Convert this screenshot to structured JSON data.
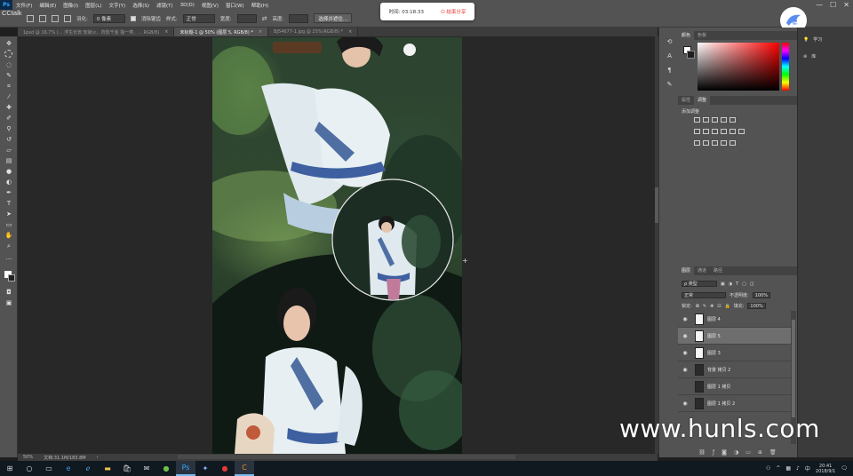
{
  "app": {
    "logo": "Ps",
    "menu": [
      "文件(F)",
      "编辑(E)",
      "图像(I)",
      "图层(L)",
      "文字(Y)",
      "选择(S)",
      "滤镜(T)",
      "3D(D)",
      "视图(V)",
      "窗口(W)",
      "帮助(H)"
    ],
    "window_controls": [
      "—",
      "☐",
      "✕"
    ]
  },
  "overlay": {
    "cctalk_label": "CCtalk",
    "timer_label": "时间: 03:18:33",
    "end_share_label": "结束分享"
  },
  "options": {
    "feather_label": "羽化:",
    "feather_value": "0 像素",
    "antialias_label": "消除锯齿",
    "style_label": "样式:",
    "style_value": "正常",
    "width_label": "宽度:",
    "height_label": "高度:",
    "select_mask_label": "选择并遮住..."
  },
  "tabs": [
    {
      "label": "1psd @ 16.7% (... 浮生长安 软锁火、背影千金 独一笑、... RGB/8)",
      "active": false
    },
    {
      "label": "未标题-1 @ 50% (图层 5, RGB/8) *",
      "active": true
    },
    {
      "label": "BJ54677-1.jpg @ 25%(RGB/8) *",
      "active": false
    }
  ],
  "status": {
    "zoom": "50%",
    "doc_size": "文档:31.1M/183.8M"
  },
  "panels": {
    "color_tabs": [
      "颜色",
      "色板"
    ],
    "adj_tabs": [
      "属性",
      "调整"
    ],
    "adj_title": "添加调整",
    "layers_tabs": [
      "图层",
      "通道",
      "路径"
    ],
    "kind_label": "ρ 类型",
    "blend_mode": "正常",
    "opacity_label": "不透明度:",
    "opacity_value": "100%",
    "lock_label": "锁定:",
    "fill_label": "填充:",
    "fill_value": "100%",
    "layers": [
      {
        "name": "图层 4",
        "selected": false
      },
      {
        "name": "图层 5",
        "selected": true
      },
      {
        "name": "图层 3",
        "selected": false
      },
      {
        "name": "背景 拷贝 2",
        "selected": false
      },
      {
        "name": "图层 1 拷贝",
        "selected": false
      },
      {
        "name": "图层 1 拷贝 2",
        "selected": false
      }
    ]
  },
  "mini_panel": {
    "learn_label": "学习",
    "lib_label": "库"
  },
  "watermark": "www.hunls.com",
  "taskbar": {
    "time": "20:41",
    "date": "2018/9/1"
  },
  "colors": {
    "ps_blue": "#31a8ff",
    "accent_red": "#e53935",
    "panel_bg": "#535353"
  }
}
